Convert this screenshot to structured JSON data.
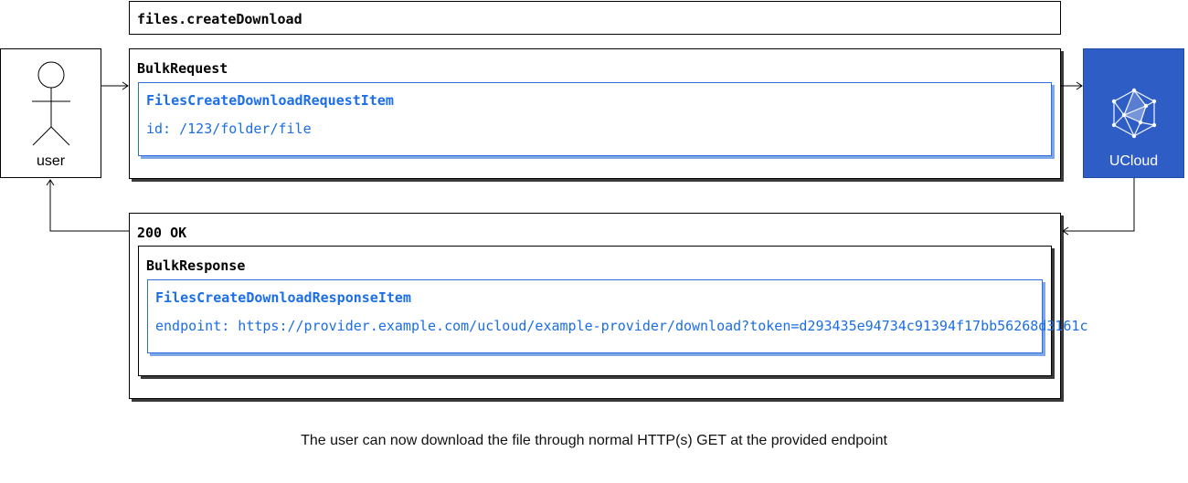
{
  "call": {
    "name": "files.createDownload"
  },
  "request": {
    "label": "BulkRequest",
    "item": {
      "title": "FilesCreateDownloadRequestItem",
      "field": "id: /123/folder/file"
    }
  },
  "response": {
    "status": "200 OK",
    "label": "BulkResponse",
    "item": {
      "title": "FilesCreateDownloadResponseItem",
      "field": "endpoint: https://provider.example.com/ucloud/example-provider/download?token=d293435e94734c91394f17bb56268d3161c"
    }
  },
  "actors": {
    "user": "user",
    "server": "UCloud"
  },
  "caption": "The user can now download the file through normal HTTP(s) GET at the provided endpoint",
  "icons": {
    "user": "stick-figure-icon",
    "server": "ucloud-logo-icon"
  },
  "colors": {
    "accent": "#1b6ee6",
    "server_bg": "#2f5dc6"
  }
}
